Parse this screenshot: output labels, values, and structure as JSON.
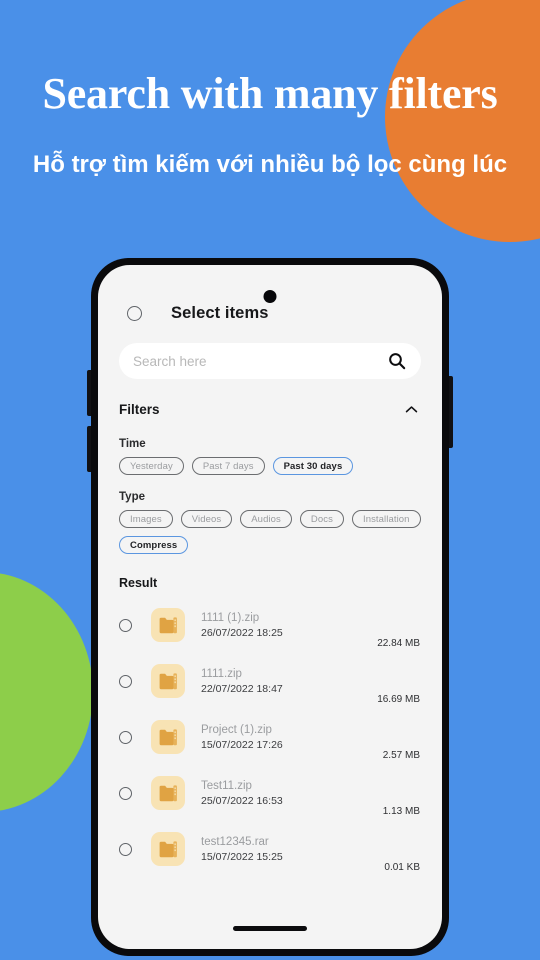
{
  "theme": {
    "background": "#4a90e8",
    "accent_orange": "#e87d32",
    "accent_green": "#8dce4a",
    "chip_selected_border": "#5b96e0",
    "file_icon_bg": "#f8e3b4",
    "file_icon_fg": "#e0a343"
  },
  "hero": {
    "title": "Search with many filters",
    "subtitle": "Hỗ trợ tìm kiếm với nhiều bộ lọc cùng lúc"
  },
  "app": {
    "header": {
      "select_all_label": "select-all-radio",
      "title": "Select items"
    },
    "search": {
      "placeholder": "Search here",
      "value": "",
      "icon": "search-icon"
    },
    "filters": {
      "title": "Filters",
      "collapse_icon": "chevron-up-icon",
      "groups": [
        {
          "label": "Time",
          "chips": [
            {
              "label": "Yesterday",
              "selected": false
            },
            {
              "label": "Past 7 days",
              "selected": false
            },
            {
              "label": "Past 30 days",
              "selected": true
            }
          ]
        },
        {
          "label": "Type",
          "chips": [
            {
              "label": "Images",
              "selected": false
            },
            {
              "label": "Videos",
              "selected": false
            },
            {
              "label": "Audios",
              "selected": false
            },
            {
              "label": "Docs",
              "selected": false
            },
            {
              "label": "Installation",
              "selected": false
            },
            {
              "label": "Compress",
              "selected": true
            }
          ]
        }
      ]
    },
    "result": {
      "label": "Result",
      "items": [
        {
          "name": "1111 (1).zip",
          "date": "26/07/2022 18:25",
          "size": "22.84 MB",
          "icon": "zip-file-icon"
        },
        {
          "name": "1111.zip",
          "date": "22/07/2022 18:47",
          "size": "16.69 MB",
          "icon": "zip-file-icon"
        },
        {
          "name": "Project (1).zip",
          "date": "15/07/2022 17:26",
          "size": "2.57 MB",
          "icon": "zip-file-icon"
        },
        {
          "name": "Test11.zip",
          "date": "25/07/2022 16:53",
          "size": "1.13 MB",
          "icon": "zip-file-icon"
        },
        {
          "name": "test12345.rar",
          "date": "15/07/2022 15:25",
          "size": "0.01 KB",
          "icon": "zip-file-icon"
        }
      ]
    }
  }
}
